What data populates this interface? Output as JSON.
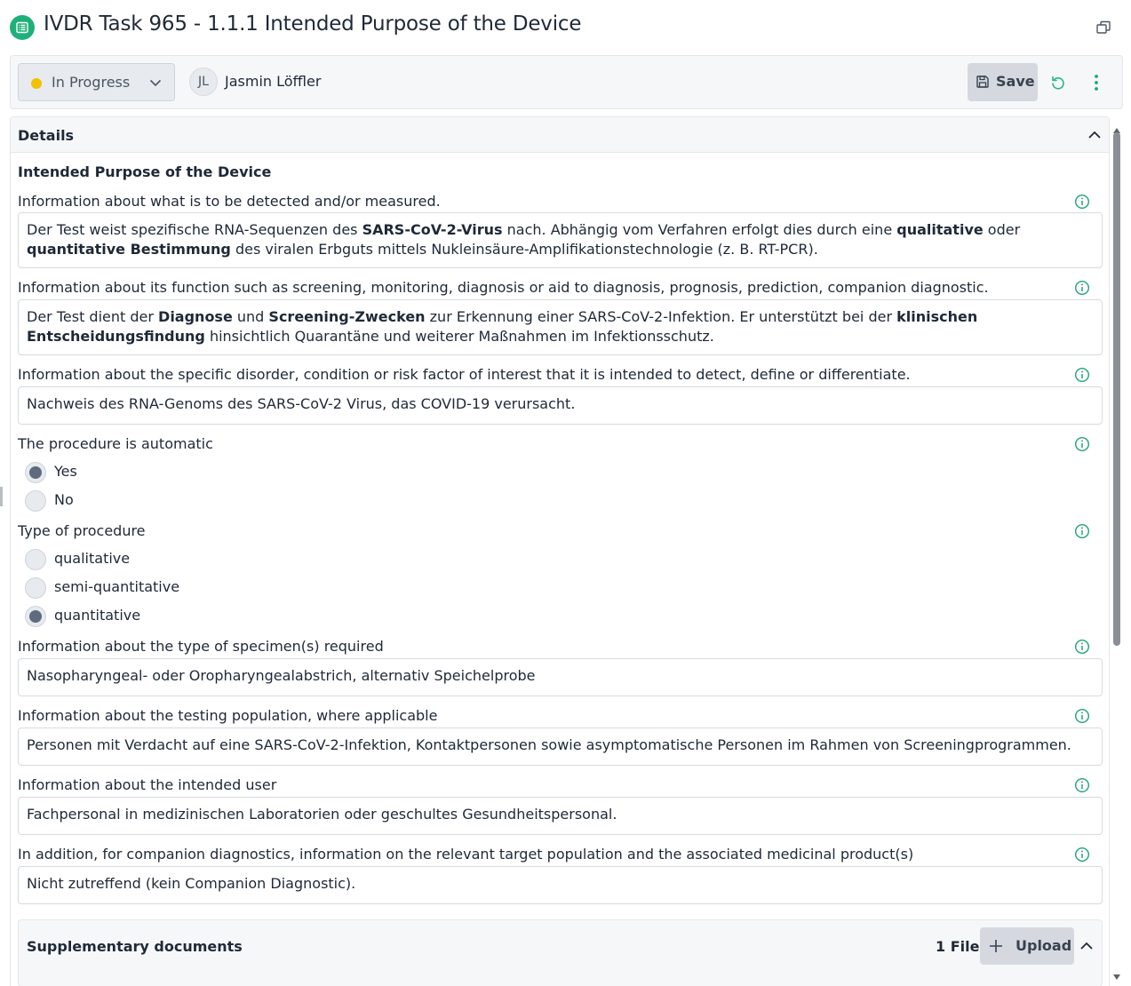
{
  "window": {
    "title": "IVDR Task 965 - 1.1.1 Intended Purpose of the Device"
  },
  "toolbar": {
    "status": "In Progress",
    "status_color": "#f2c200",
    "assignee_initials": "JL",
    "assignee_name": "Jasmin Löffler",
    "save_label": "Save"
  },
  "panel": {
    "title": "Details",
    "section_heading": "Intended Purpose of the Device",
    "fields": [
      {
        "label": "Information about what is to be detected and/or measured.",
        "value": [
          {
            "t": "Der Test weist spezifische RNA-Sequenzen des "
          },
          {
            "t": "SARS-CoV-2-Virus",
            "b": true
          },
          {
            "t": " nach. Abhängig vom Verfahren erfolgt dies durch eine "
          },
          {
            "t": "qualitative",
            "b": true
          },
          {
            "t": " oder "
          },
          {
            "t": "quantitative Bestimmung",
            "b": true
          },
          {
            "t": " des viralen Erbguts mittels Nukleinsäure-Amplifikationstechnologie (z. B. RT-PCR)."
          }
        ]
      },
      {
        "label": "Information about its function such as screening, monitoring, diagnosis or aid to diagnosis, prognosis, prediction, companion diagnostic.",
        "value": [
          {
            "t": "Der Test dient der "
          },
          {
            "t": "Diagnose",
            "b": true
          },
          {
            "t": " und "
          },
          {
            "t": "Screening-Zwecken",
            "b": true
          },
          {
            "t": " zur Erkennung einer SARS-CoV-2-Infektion. Er unterstützt bei der "
          },
          {
            "t": "klinischen Entscheidungsfindung",
            "b": true
          },
          {
            "t": " hinsichtlich Quarantäne und weiterer Maßnahmen im Infektionsschutz."
          }
        ]
      },
      {
        "label": "Information about the specific disorder, condition or risk factor of interest that it is intended to detect, define or differentiate.",
        "value": [
          {
            "t": "Nachweis des RNA-Genoms des SARS-CoV-2 Virus, das COVID-19 verursacht."
          }
        ]
      }
    ],
    "automatic": {
      "label": "The procedure is automatic",
      "options": [
        "Yes",
        "No"
      ],
      "selected": "Yes"
    },
    "procedure_type": {
      "label": "Type of procedure",
      "options": [
        "qualitative",
        "semi-quantitative",
        "quantitative"
      ],
      "selected": "quantitative"
    },
    "fields2": [
      {
        "label": "Information about the type of specimen(s) required",
        "value": "Nasopharyngeal- oder Oropharyngealabstrich, alternativ Speichelprobe"
      },
      {
        "label": "Information about the testing population, where applicable",
        "value": "Personen mit Verdacht auf eine SARS-CoV-2-Infektion, Kontaktpersonen sowie asymptomatische Personen im Rahmen von Screeningprogrammen."
      },
      {
        "label": "Information about the intended user",
        "value": "Fachpersonal in medizinischen Laboratorien oder geschultes Gesundheitspersonal."
      },
      {
        "label": "In addition, for companion diagnostics, information on the relevant target population and the associated medicinal product(s)",
        "value": "Nicht zutreffend (kein Companion Diagnostic)."
      }
    ],
    "supplementary": {
      "title": "Supplementary documents",
      "count": "1 File",
      "upload_label": "Upload"
    }
  },
  "colors": {
    "app_icon": "#1fb07a",
    "info_icon": "#1fa37a",
    "undo_icon": "#2bb58a",
    "more_icon": "#17a57a"
  },
  "icons": {
    "app": "list-icon",
    "popout": "popout-icon",
    "status_dropdown": "chevron-down-icon",
    "save": "save-icon",
    "undo": "undo-icon",
    "more": "more-vertical-icon",
    "collapse": "chevron-up-icon",
    "info": "info-icon",
    "upload": "plus-icon"
  }
}
